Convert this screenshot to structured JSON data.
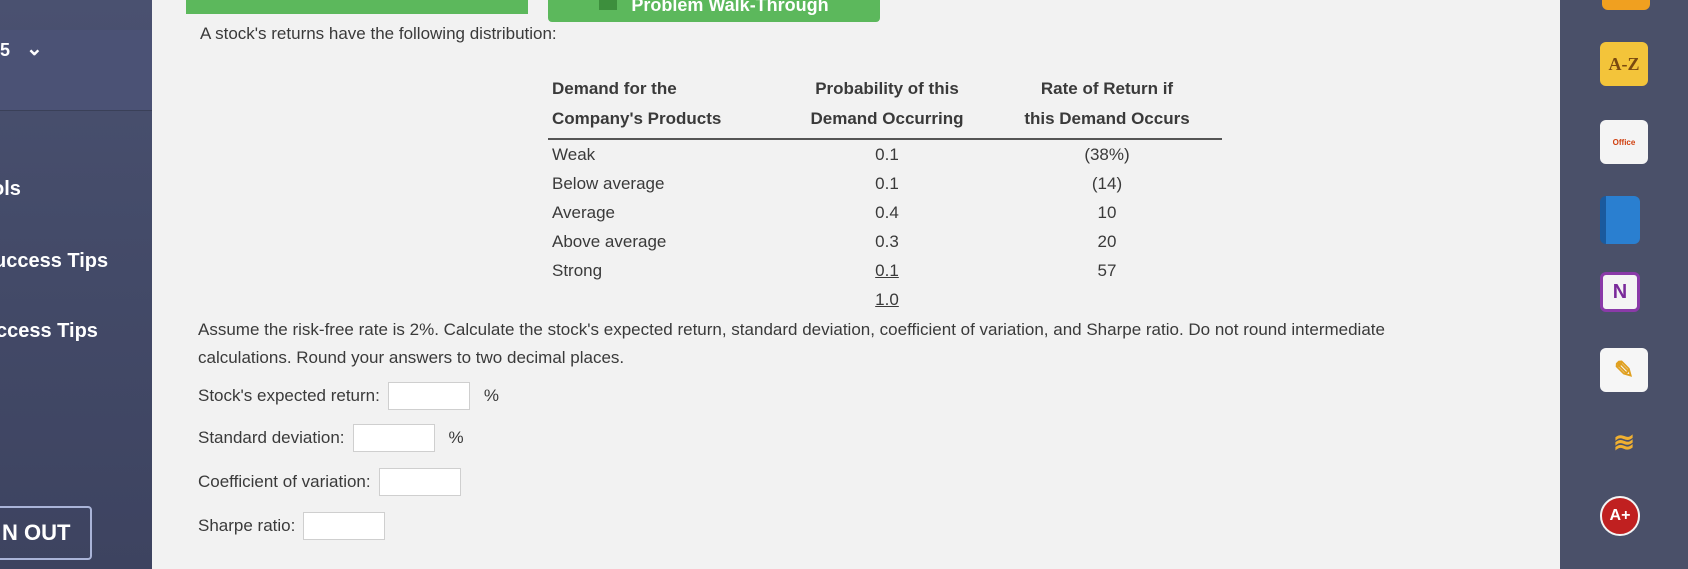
{
  "header": {
    "walkthrough_button": "Problem Walk-Through"
  },
  "sidebar": {
    "top_number": "5",
    "items": [
      {
        "label": "ols"
      },
      {
        "label": "uccess Tips"
      },
      {
        "label": "ccess Tips"
      }
    ],
    "logout_label": "N OUT"
  },
  "problem": {
    "intro": "A stock's returns have the following distribution:",
    "table": {
      "headers": [
        [
          "Demand for the",
          "Company's Products"
        ],
        [
          "Probability of this",
          "Demand Occurring"
        ],
        [
          "Rate of Return if",
          "this Demand Occurs"
        ]
      ],
      "rows": [
        {
          "demand": "Weak",
          "probability": "0.1",
          "return": "(38%)"
        },
        {
          "demand": "Below average",
          "probability": "0.1",
          "return": "(14)"
        },
        {
          "demand": "Average",
          "probability": "0.4",
          "return": "10"
        },
        {
          "demand": "Above average",
          "probability": "0.3",
          "return": "20"
        },
        {
          "demand": "Strong",
          "probability": "0.1",
          "return": "57"
        }
      ],
      "probability_total": "1.0"
    },
    "instructions": "Assume the risk-free rate is 2%. Calculate the stock's expected return, standard deviation, coefficient of variation, and Sharpe ratio. Do not round intermediate calculations. Round your answers to two decimal places.",
    "fields": [
      {
        "label": "Stock's expected return:",
        "value": "",
        "unit": "%"
      },
      {
        "label": "Standard deviation:",
        "value": "",
        "unit": "%"
      },
      {
        "label": "Coefficient of variation:",
        "value": "",
        "unit": ""
      },
      {
        "label": "Sharpe ratio:",
        "value": "",
        "unit": ""
      }
    ]
  },
  "dock": {
    "icons": [
      {
        "name": "dictionary-az-icon",
        "text": "A-Z"
      },
      {
        "name": "office-icon",
        "text": "Office"
      },
      {
        "name": "book-icon",
        "text": ""
      },
      {
        "name": "onenote-icon",
        "text": "N"
      },
      {
        "name": "notes-pencil-icon",
        "text": ""
      },
      {
        "name": "voice-icon",
        "text": ""
      },
      {
        "name": "grade-plus-icon",
        "text": "A+"
      }
    ]
  },
  "colors": {
    "sidebar": "#444b69",
    "main_bg": "#f2f2f2",
    "accent_green": "#5cb85c",
    "dock": "#4a5069"
  }
}
